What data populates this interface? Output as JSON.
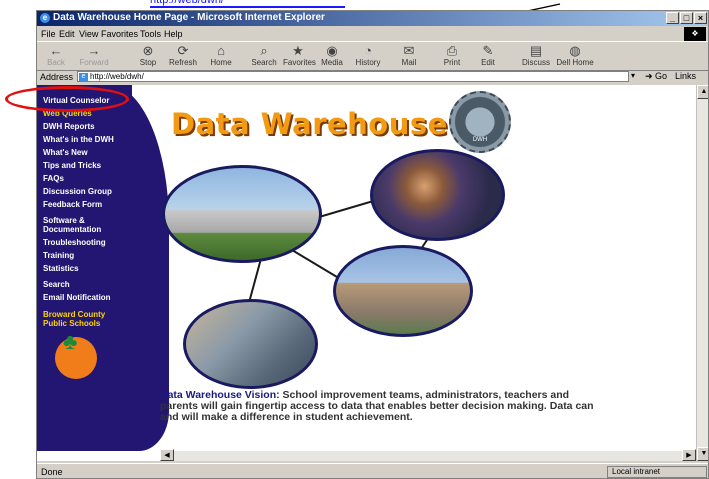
{
  "top_link": "http://web/dwh/",
  "window": {
    "title": "Data Warehouse Home Page - Microsoft Internet Explorer",
    "controls": [
      "_",
      "□",
      "×"
    ]
  },
  "menu": [
    "File",
    "Edit",
    "View",
    "Favorites",
    "Tools",
    "Help"
  ],
  "toolbar": [
    {
      "label": "Back",
      "icon": "back-arrow-icon"
    },
    {
      "label": "Forward",
      "icon": "forward-arrow-icon"
    },
    {
      "label": "Stop",
      "icon": "stop-icon"
    },
    {
      "label": "Refresh",
      "icon": "refresh-icon"
    },
    {
      "label": "Home",
      "icon": "home-icon"
    },
    {
      "label": "Search",
      "icon": "search-icon"
    },
    {
      "label": "Favorites",
      "icon": "favorites-icon"
    },
    {
      "label": "Media",
      "icon": "media-icon"
    },
    {
      "label": "History",
      "icon": "history-icon"
    },
    {
      "label": "Mail",
      "icon": "mail-icon"
    },
    {
      "label": "Print",
      "icon": "print-icon"
    },
    {
      "label": "Edit",
      "icon": "edit-icon"
    },
    {
      "label": "Discuss",
      "icon": "discuss-icon"
    },
    {
      "label": "Dell Home",
      "icon": "dell-home-icon"
    }
  ],
  "address": {
    "label": "Address",
    "url": "http://web/dwh/",
    "go": "Go",
    "links": "Links"
  },
  "sidebar": {
    "items": [
      {
        "label": "Virtual Counselor"
      },
      {
        "label": "Web Queries"
      },
      {
        "label": "DWH Reports"
      },
      {
        "label": "What's in the DWH"
      },
      {
        "label": "What's New"
      },
      {
        "label": "Tips and Tricks"
      },
      {
        "label": "FAQs"
      },
      {
        "label": "Discussion Group"
      },
      {
        "label": "Feedback Form"
      },
      {
        "label": "Software & Documentation"
      },
      {
        "label": "Troubleshooting"
      },
      {
        "label": "Training"
      },
      {
        "label": "Statistics"
      },
      {
        "label": "Search"
      },
      {
        "label": "Email Notification"
      }
    ],
    "org": "Broward County Public Schools"
  },
  "page": {
    "title": "Data Warehouse",
    "seal_text": "DWH",
    "vision_label": "Data Warehouse Vision:",
    "vision_text": " School improvement teams, administrators, teachers and parents will gain fingertip access to data that enables better decision making. Data can and will make a difference in student achievement."
  },
  "status": {
    "left": "Done",
    "zone": "Local intranet"
  },
  "colors": {
    "sidebar": "#231672",
    "title_orange": "#f29a12",
    "highlight_red": "#e01010"
  }
}
